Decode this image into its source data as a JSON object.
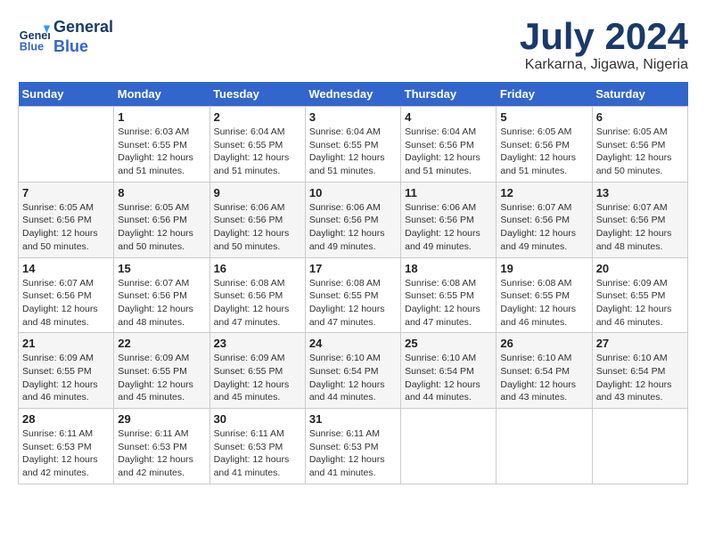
{
  "header": {
    "logo_line1": "General",
    "logo_line2": "Blue",
    "month_title": "July 2024",
    "location": "Karkarna, Jigawa, Nigeria"
  },
  "weekdays": [
    "Sunday",
    "Monday",
    "Tuesday",
    "Wednesday",
    "Thursday",
    "Friday",
    "Saturday"
  ],
  "weeks": [
    [
      null,
      {
        "day": 1,
        "sunrise": "6:03 AM",
        "sunset": "6:55 PM",
        "daylight": "12 hours and 51 minutes."
      },
      {
        "day": 2,
        "sunrise": "6:04 AM",
        "sunset": "6:55 PM",
        "daylight": "12 hours and 51 minutes."
      },
      {
        "day": 3,
        "sunrise": "6:04 AM",
        "sunset": "6:55 PM",
        "daylight": "12 hours and 51 minutes."
      },
      {
        "day": 4,
        "sunrise": "6:04 AM",
        "sunset": "6:56 PM",
        "daylight": "12 hours and 51 minutes."
      },
      {
        "day": 5,
        "sunrise": "6:05 AM",
        "sunset": "6:56 PM",
        "daylight": "12 hours and 51 minutes."
      },
      {
        "day": 6,
        "sunrise": "6:05 AM",
        "sunset": "6:56 PM",
        "daylight": "12 hours and 50 minutes."
      }
    ],
    [
      {
        "day": 7,
        "sunrise": "6:05 AM",
        "sunset": "6:56 PM",
        "daylight": "12 hours and 50 minutes."
      },
      {
        "day": 8,
        "sunrise": "6:05 AM",
        "sunset": "6:56 PM",
        "daylight": "12 hours and 50 minutes."
      },
      {
        "day": 9,
        "sunrise": "6:06 AM",
        "sunset": "6:56 PM",
        "daylight": "12 hours and 50 minutes."
      },
      {
        "day": 10,
        "sunrise": "6:06 AM",
        "sunset": "6:56 PM",
        "daylight": "12 hours and 49 minutes."
      },
      {
        "day": 11,
        "sunrise": "6:06 AM",
        "sunset": "6:56 PM",
        "daylight": "12 hours and 49 minutes."
      },
      {
        "day": 12,
        "sunrise": "6:07 AM",
        "sunset": "6:56 PM",
        "daylight": "12 hours and 49 minutes."
      },
      {
        "day": 13,
        "sunrise": "6:07 AM",
        "sunset": "6:56 PM",
        "daylight": "12 hours and 48 minutes."
      }
    ],
    [
      {
        "day": 14,
        "sunrise": "6:07 AM",
        "sunset": "6:56 PM",
        "daylight": "12 hours and 48 minutes."
      },
      {
        "day": 15,
        "sunrise": "6:07 AM",
        "sunset": "6:56 PM",
        "daylight": "12 hours and 48 minutes."
      },
      {
        "day": 16,
        "sunrise": "6:08 AM",
        "sunset": "6:56 PM",
        "daylight": "12 hours and 47 minutes."
      },
      {
        "day": 17,
        "sunrise": "6:08 AM",
        "sunset": "6:55 PM",
        "daylight": "12 hours and 47 minutes."
      },
      {
        "day": 18,
        "sunrise": "6:08 AM",
        "sunset": "6:55 PM",
        "daylight": "12 hours and 47 minutes."
      },
      {
        "day": 19,
        "sunrise": "6:08 AM",
        "sunset": "6:55 PM",
        "daylight": "12 hours and 46 minutes."
      },
      {
        "day": 20,
        "sunrise": "6:09 AM",
        "sunset": "6:55 PM",
        "daylight": "12 hours and 46 minutes."
      }
    ],
    [
      {
        "day": 21,
        "sunrise": "6:09 AM",
        "sunset": "6:55 PM",
        "daylight": "12 hours and 46 minutes."
      },
      {
        "day": 22,
        "sunrise": "6:09 AM",
        "sunset": "6:55 PM",
        "daylight": "12 hours and 45 minutes."
      },
      {
        "day": 23,
        "sunrise": "6:09 AM",
        "sunset": "6:55 PM",
        "daylight": "12 hours and 45 minutes."
      },
      {
        "day": 24,
        "sunrise": "6:10 AM",
        "sunset": "6:54 PM",
        "daylight": "12 hours and 44 minutes."
      },
      {
        "day": 25,
        "sunrise": "6:10 AM",
        "sunset": "6:54 PM",
        "daylight": "12 hours and 44 minutes."
      },
      {
        "day": 26,
        "sunrise": "6:10 AM",
        "sunset": "6:54 PM",
        "daylight": "12 hours and 43 minutes."
      },
      {
        "day": 27,
        "sunrise": "6:10 AM",
        "sunset": "6:54 PM",
        "daylight": "12 hours and 43 minutes."
      }
    ],
    [
      {
        "day": 28,
        "sunrise": "6:11 AM",
        "sunset": "6:53 PM",
        "daylight": "12 hours and 42 minutes."
      },
      {
        "day": 29,
        "sunrise": "6:11 AM",
        "sunset": "6:53 PM",
        "daylight": "12 hours and 42 minutes."
      },
      {
        "day": 30,
        "sunrise": "6:11 AM",
        "sunset": "6:53 PM",
        "daylight": "12 hours and 41 minutes."
      },
      {
        "day": 31,
        "sunrise": "6:11 AM",
        "sunset": "6:53 PM",
        "daylight": "12 hours and 41 minutes."
      },
      null,
      null,
      null
    ]
  ]
}
